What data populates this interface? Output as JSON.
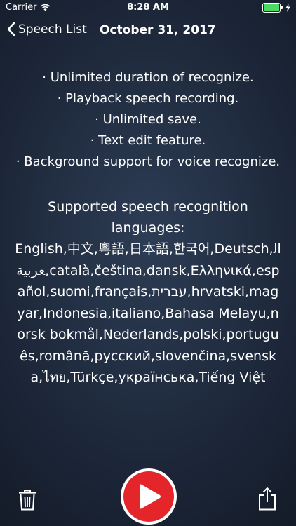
{
  "status_bar": {
    "carrier": "Carrier",
    "time": "8:28 AM",
    "battery_level": 1.0,
    "icons": [
      "wifi-icon",
      "battery-icon",
      "charging-bolt-icon"
    ]
  },
  "nav": {
    "back_label": "Speech List",
    "title": "October 31, 2017"
  },
  "features": [
    "· Unlimited duration of recognize.",
    "· Playback speech recording.",
    "· Unlimited save.",
    "· Text edit feature.",
    "· Background support for voice recognize."
  ],
  "languages": {
    "heading": "Supported speech recognition languages:",
    "list": "English,中文,粵語,日本語,한국어,Deutsch,العربية,català,čeština,dansk,Ελληνικά,español,suomi,français,עברית,hrvatski,magyar,Indonesia,italiano,Bahasa Melayu,norsk bokmål,Nederlands,polski,português,română,русский,slovenčina,svenska,ไทย,Türkçe,українська,Tiếng Việt"
  },
  "bottom_bar": {
    "icons": [
      "trash-icon",
      "play-icon",
      "share-icon"
    ]
  },
  "colors": {
    "play_button": "#e4262a",
    "battery_fill": "#4cd964",
    "background": "#1c2638"
  }
}
